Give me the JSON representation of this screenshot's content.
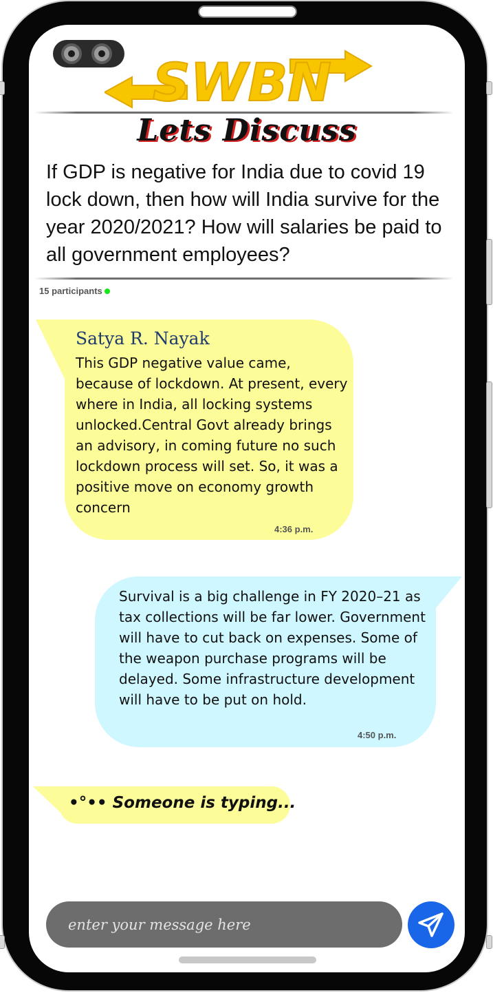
{
  "header": {
    "logo_text": "SWBN",
    "title": "Lets Discuss"
  },
  "question": "If GDP is negative for India due to covid 19 lock down, then how will India survive for the year 2020/2021? How will salaries be paid to all government employees?",
  "participants": {
    "label": "15 participants"
  },
  "messages": [
    {
      "sender": "Satya R. Nayak",
      "text": "This GDP negative value came, because of lockdown. At present, every where in India, all locking systems unlocked.Central Govt already brings an advisory, in coming future no such lockdown process will set. So, it was a positive move on economy growth concern",
      "time": "4:36 p.m.",
      "bubble_color": "#fcfc98"
    },
    {
      "text": "Survival is a big challenge in FY 2020–21 as tax collections will be far lower. Government will have to cut back on expenses. Some of the weapon purchase programs will be delayed. Some infrastructure development will have to be put on hold.",
      "time": "4:50 p.m.",
      "bubble_color": "#cff7ff"
    }
  ],
  "typing": {
    "text": "•°•• Someone is typing..."
  },
  "composer": {
    "placeholder": "enter your message here"
  },
  "colors": {
    "logo_yellow": "#f7c600",
    "send_blue": "#1a66e8",
    "input_gray": "#6d6d6d",
    "online_green": "#19e619"
  },
  "icons": {
    "send": "paper-plane-icon",
    "camera": "camera-icon"
  }
}
